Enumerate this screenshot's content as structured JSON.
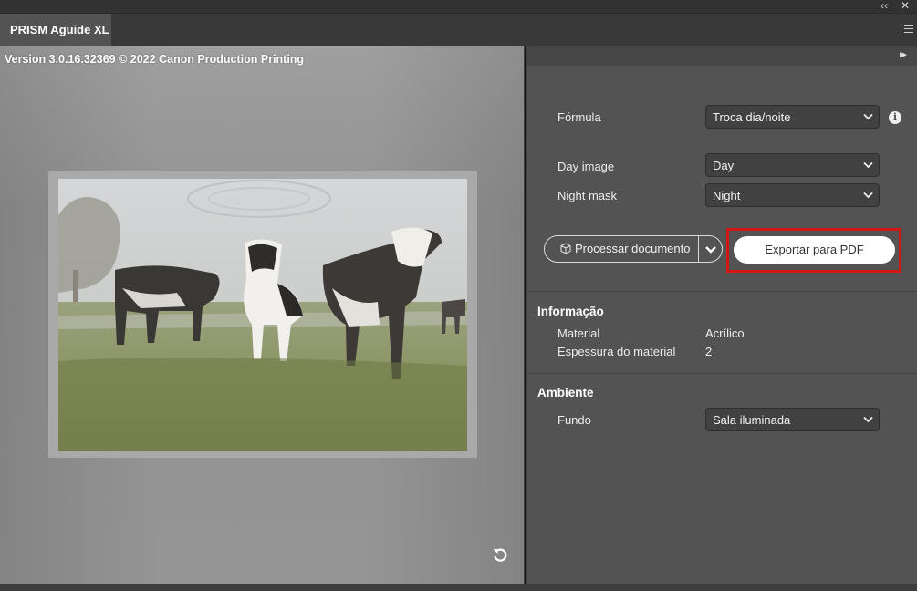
{
  "window": {
    "collapse_glyph": "‹‹",
    "close_glyph": "✕",
    "tab_title": "PRISM Aguide XL",
    "panel_menu_icon": "hamburger-menu-icon"
  },
  "preview": {
    "version_text": "Version 3.0.16.32369 © 2022 Canon Production Printing",
    "image_icon": "cows-in-field-photo",
    "rotate_icon": "rotate-icon"
  },
  "panel": {
    "expand_glyph": "▸▸",
    "formula_label": "Fórmula",
    "formula_value": "Troca dia/noite",
    "day_image_label": "Day image",
    "day_image_value": "Day",
    "night_mask_label": "Night mask",
    "night_mask_value": "Night",
    "process_button": "Processar documento",
    "export_button": "Exportar para PDF"
  },
  "info": {
    "title": "Informação",
    "material_label": "Material",
    "material_value": "Acrílico",
    "thickness_label": "Espessura do material",
    "thickness_value": "2"
  },
  "environment": {
    "title": "Ambiente",
    "background_label": "Fundo",
    "background_value": "Sala iluminada"
  },
  "colors": {
    "highlight": "#d01616",
    "panel_bg": "#535353",
    "export_bg": "#ffffff"
  }
}
